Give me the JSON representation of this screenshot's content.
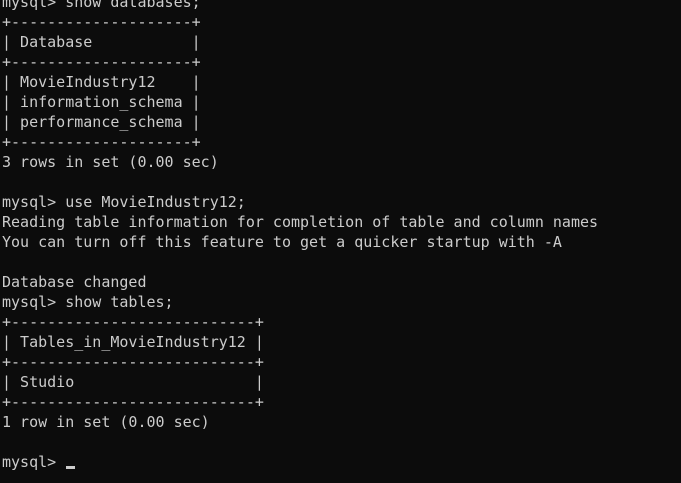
{
  "terminal": {
    "prompt": "mysql> ",
    "lines": [
      "mysql> show databases;",
      "+--------------------+",
      "| Database           |",
      "+--------------------+",
      "| MovieIndustry12    |",
      "| information_schema |",
      "| performance_schema |",
      "+--------------------+",
      "3 rows in set (0.00 sec)",
      "",
      "mysql> use MovieIndustry12;",
      "Reading table information for completion of table and column names",
      "You can turn off this feature to get a quicker startup with -A",
      "",
      "Database changed",
      "mysql> show tables;",
      "+---------------------------+",
      "| Tables_in_MovieIndustry12 |",
      "+---------------------------+",
      "| Studio                    |",
      "+---------------------------+",
      "1 row in set (0.00 sec)",
      "",
      "mysql> "
    ],
    "colors": {
      "background": "#0c0c0c",
      "foreground": "#cccccc"
    }
  }
}
